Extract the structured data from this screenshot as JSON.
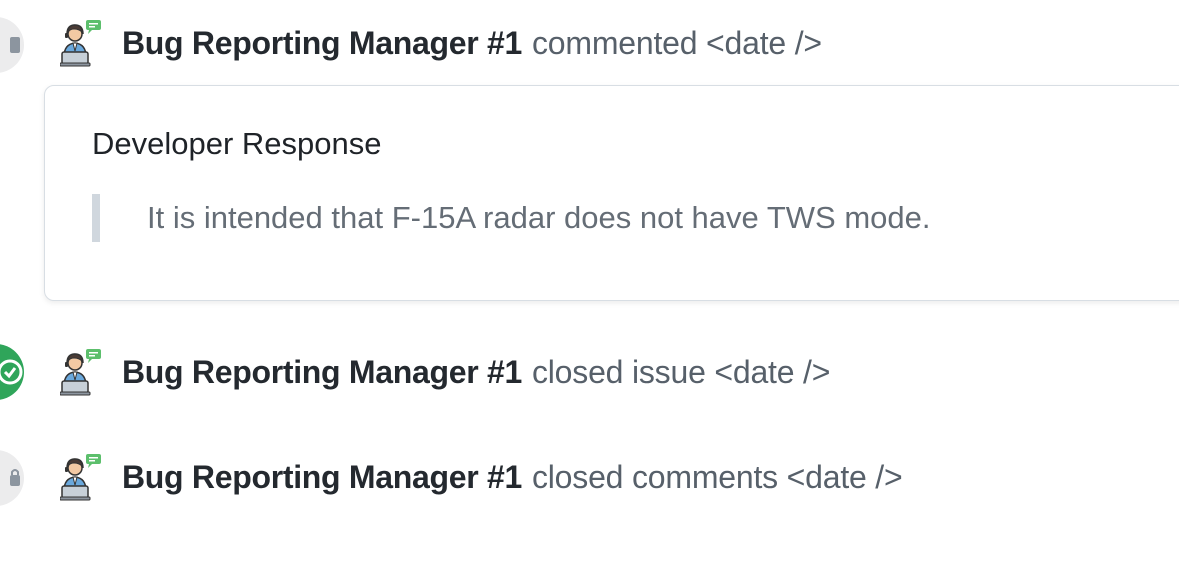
{
  "events": [
    {
      "actor": "Bug Reporting Manager #1",
      "action": "commented <date />",
      "badge_color": "#ececed",
      "badge_icon": "comment-icon"
    },
    {
      "actor": "Bug Reporting Manager #1",
      "action": "closed issue <date />",
      "badge_color": "#2fa55a",
      "badge_icon": "check-circle-icon"
    },
    {
      "actor": "Bug Reporting Manager #1",
      "action": "closed comments <date />",
      "badge_color": "#ececed",
      "badge_icon": "lock-icon"
    }
  ],
  "comment": {
    "heading": "Developer Response",
    "quote": "It is intended that F-15A radar does not have TWS mode."
  },
  "avatar_icon": "support-agent-avatar-icon"
}
